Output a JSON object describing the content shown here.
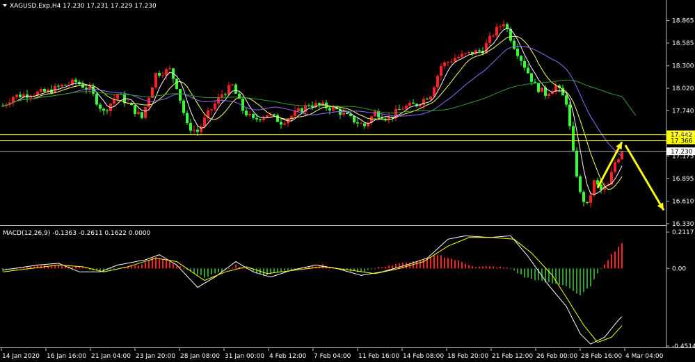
{
  "header": {
    "symbol_line": "XAGUSD.Exp,H4  17.230 17.231 17.229 17.230"
  },
  "colors": {
    "background": "#000000",
    "axis": "#c0c0c0",
    "bull_candle": "#ff2020",
    "bear_candle": "#33ff33",
    "ma_fast": "#ffffff",
    "ma_mid": "#ffff66",
    "ma_slow": "#9966ff",
    "ma_long": "#2e9e2e",
    "level_line": "#ffff00",
    "bid_line": "#aabbd0",
    "arrow": "#ffff00",
    "macd_pos": "#ff2020",
    "macd_neg": "#2e9e2e",
    "macd_line": "#ffffff",
    "signal_line": "#ffff00"
  },
  "chart_data": [
    {
      "type": "candlestick",
      "title": "XAGUSD.Exp,H4  17.230 17.231 17.229 17.230",
      "timeframe": "H4",
      "ylim": [
        16.33,
        19.0
      ],
      "y_ticks": [
        "18.865",
        "18.585",
        "18.300",
        "18.020",
        "17.740",
        "17.455",
        "17.175",
        "16.895",
        "16.610",
        "16.330"
      ],
      "x_ticks": [
        "14 Jan 2020",
        "16 Jan 16:00",
        "21 Jan 04:00",
        "23 Jan 20:00",
        "28 Jan 08:00",
        "31 Jan 00:00",
        "4 Feb 12:00",
        "7 Feb 04:00",
        "11 Feb 16:00",
        "14 Feb 08:00",
        "18 Feb 20:00",
        "21 Feb 12:00",
        "26 Feb 00:00",
        "28 Feb 16:00",
        "4 Mar 04:00"
      ],
      "levels": [
        {
          "label": "17.442",
          "value": 17.442
        },
        {
          "label": "17.366",
          "value": 17.366
        }
      ],
      "bid": {
        "label": "17.230",
        "value": 17.23
      },
      "price_path": [
        {
          "bar": 0,
          "price": 17.8
        },
        {
          "bar": 3,
          "price": 17.92
        },
        {
          "bar": 8,
          "price": 17.95
        },
        {
          "bar": 13,
          "price": 17.98
        },
        {
          "bar": 17,
          "price": 18.05
        },
        {
          "bar": 21,
          "price": 18.1
        },
        {
          "bar": 25,
          "price": 18.0
        },
        {
          "bar": 29,
          "price": 17.72
        },
        {
          "bar": 33,
          "price": 17.95
        },
        {
          "bar": 37,
          "price": 17.78
        },
        {
          "bar": 40,
          "price": 17.65
        },
        {
          "bar": 44,
          "price": 18.2
        },
        {
          "bar": 48,
          "price": 18.25
        },
        {
          "bar": 50,
          "price": 18.05
        },
        {
          "bar": 53,
          "price": 17.55
        },
        {
          "bar": 56,
          "price": 17.48
        },
        {
          "bar": 59,
          "price": 17.7
        },
        {
          "bar": 63,
          "price": 17.95
        },
        {
          "bar": 66,
          "price": 18.05
        },
        {
          "bar": 69,
          "price": 17.75
        },
        {
          "bar": 72,
          "price": 17.62
        },
        {
          "bar": 76,
          "price": 17.7
        },
        {
          "bar": 80,
          "price": 17.6
        },
        {
          "bar": 84,
          "price": 17.7
        },
        {
          "bar": 88,
          "price": 17.82
        },
        {
          "bar": 92,
          "price": 17.8
        },
        {
          "bar": 96,
          "price": 17.75
        },
        {
          "bar": 100,
          "price": 17.64
        },
        {
          "bar": 104,
          "price": 17.55
        },
        {
          "bar": 107,
          "price": 17.72
        },
        {
          "bar": 111,
          "price": 17.65
        },
        {
          "bar": 115,
          "price": 17.78
        },
        {
          "bar": 119,
          "price": 17.82
        },
        {
          "bar": 123,
          "price": 17.95
        },
        {
          "bar": 126,
          "price": 18.3
        },
        {
          "bar": 130,
          "price": 18.4
        },
        {
          "bar": 134,
          "price": 18.45
        },
        {
          "bar": 138,
          "price": 18.5
        },
        {
          "bar": 141,
          "price": 18.7
        },
        {
          "bar": 144,
          "price": 18.85
        },
        {
          "bar": 147,
          "price": 18.55
        },
        {
          "bar": 150,
          "price": 18.3
        },
        {
          "bar": 153,
          "price": 18.05
        },
        {
          "bar": 156,
          "price": 17.95
        },
        {
          "bar": 159,
          "price": 18.05
        },
        {
          "bar": 162,
          "price": 17.85
        },
        {
          "bar": 164,
          "price": 17.2
        },
        {
          "bar": 166,
          "price": 16.7
        },
        {
          "bar": 168,
          "price": 16.55
        },
        {
          "bar": 170,
          "price": 16.85
        },
        {
          "bar": 172,
          "price": 16.75
        },
        {
          "bar": 174,
          "price": 16.8
        },
        {
          "bar": 176,
          "price": 17.1
        },
        {
          "bar": 178,
          "price": 17.23
        }
      ],
      "arrows": [
        {
          "from": {
            "bar": 171,
            "price": 16.78
          },
          "to": {
            "bar": 178,
            "price": 17.35
          }
        },
        {
          "from": {
            "bar": 179,
            "price": 17.31
          },
          "to": {
            "bar": 190,
            "price": 16.5
          }
        }
      ]
    },
    {
      "type": "bar",
      "title": "MACD(12,26,9) -0.1363 -0.2611 0.1622 0.0000",
      "ylim": [
        -0.4514,
        0.2117
      ],
      "y_ticks": [
        "0.2117",
        "0.00",
        "-0.4514"
      ],
      "series": [
        {
          "values_path": [
            {
              "bar": 0,
              "v": -0.01
            },
            {
              "bar": 6,
              "v": 0.01
            },
            {
              "bar": 11,
              "v": 0.02
            },
            {
              "bar": 16,
              "v": 0.015
            },
            {
              "bar": 23,
              "v": 0.01
            },
            {
              "bar": 28,
              "v": -0.02
            },
            {
              "bar": 33,
              "v": 0.0
            },
            {
              "bar": 40,
              "v": 0.02
            },
            {
              "bar": 44,
              "v": 0.07
            },
            {
              "bar": 48,
              "v": 0.04
            },
            {
              "bar": 53,
              "v": -0.01
            },
            {
              "bar": 58,
              "v": -0.05
            },
            {
              "bar": 63,
              "v": -0.02
            },
            {
              "bar": 67,
              "v": 0.02
            },
            {
              "bar": 71,
              "v": -0.01
            },
            {
              "bar": 75,
              "v": -0.04
            },
            {
              "bar": 80,
              "v": -0.02
            },
            {
              "bar": 86,
              "v": 0.01
            },
            {
              "bar": 92,
              "v": 0.02
            },
            {
              "bar": 98,
              "v": -0.01
            },
            {
              "bar": 103,
              "v": -0.02
            },
            {
              "bar": 109,
              "v": 0.01
            },
            {
              "bar": 115,
              "v": 0.03
            },
            {
              "bar": 121,
              "v": 0.05
            },
            {
              "bar": 125,
              "v": 0.08
            },
            {
              "bar": 130,
              "v": 0.05
            },
            {
              "bar": 136,
              "v": 0.01
            },
            {
              "bar": 142,
              "v": 0.01
            },
            {
              "bar": 146,
              "v": 0.0
            },
            {
              "bar": 150,
              "v": -0.05
            },
            {
              "bar": 156,
              "v": -0.08
            },
            {
              "bar": 162,
              "v": -0.1
            },
            {
              "bar": 166,
              "v": -0.16
            },
            {
              "bar": 169,
              "v": -0.1
            },
            {
              "bar": 172,
              "v": 0.0
            },
            {
              "bar": 175,
              "v": 0.08
            },
            {
              "bar": 178,
              "v": 0.15
            }
          ]
        },
        {
          "macd_path": [
            {
              "bar": 0,
              "v": -0.01
            },
            {
              "bar": 5,
              "v": 0.005
            },
            {
              "bar": 10,
              "v": 0.02
            },
            {
              "bar": 16,
              "v": 0.03
            },
            {
              "bar": 22,
              "v": -0.02
            },
            {
              "bar": 28,
              "v": -0.02
            },
            {
              "bar": 33,
              "v": 0.02
            },
            {
              "bar": 41,
              "v": 0.05
            },
            {
              "bar": 45,
              "v": 0.08
            },
            {
              "bar": 50,
              "v": 0.02
            },
            {
              "bar": 56,
              "v": -0.11
            },
            {
              "bar": 61,
              "v": -0.05
            },
            {
              "bar": 67,
              "v": 0.04
            },
            {
              "bar": 72,
              "v": -0.02
            },
            {
              "bar": 77,
              "v": -0.05
            },
            {
              "bar": 83,
              "v": -0.01
            },
            {
              "bar": 90,
              "v": 0.02
            },
            {
              "bar": 96,
              "v": 0.0
            },
            {
              "bar": 103,
              "v": -0.04
            },
            {
              "bar": 109,
              "v": -0.02
            },
            {
              "bar": 116,
              "v": 0.02
            },
            {
              "bar": 122,
              "v": 0.06
            },
            {
              "bar": 128,
              "v": 0.17
            },
            {
              "bar": 133,
              "v": 0.19
            },
            {
              "bar": 140,
              "v": 0.18
            },
            {
              "bar": 146,
              "v": 0.19
            },
            {
              "bar": 151,
              "v": 0.07
            },
            {
              "bar": 157,
              "v": -0.1
            },
            {
              "bar": 162,
              "v": -0.22
            },
            {
              "bar": 166,
              "v": -0.38
            },
            {
              "bar": 169,
              "v": -0.44
            },
            {
              "bar": 173,
              "v": -0.4
            },
            {
              "bar": 177,
              "v": -0.3
            },
            {
              "bar": 179,
              "v": -0.26
            }
          ]
        },
        {
          "signal_path": [
            {
              "bar": 0,
              "v": -0.02
            },
            {
              "bar": 8,
              "v": 0.0
            },
            {
              "bar": 16,
              "v": 0.02
            },
            {
              "bar": 23,
              "v": 0.01
            },
            {
              "bar": 29,
              "v": -0.02
            },
            {
              "bar": 36,
              "v": 0.01
            },
            {
              "bar": 44,
              "v": 0.06
            },
            {
              "bar": 50,
              "v": 0.04
            },
            {
              "bar": 58,
              "v": -0.07
            },
            {
              "bar": 64,
              "v": -0.02
            },
            {
              "bar": 70,
              "v": 0.01
            },
            {
              "bar": 76,
              "v": -0.03
            },
            {
              "bar": 84,
              "v": -0.01
            },
            {
              "bar": 92,
              "v": 0.01
            },
            {
              "bar": 100,
              "v": -0.01
            },
            {
              "bar": 107,
              "v": -0.03
            },
            {
              "bar": 114,
              "v": 0.0
            },
            {
              "bar": 121,
              "v": 0.04
            },
            {
              "bar": 128,
              "v": 0.13
            },
            {
              "bar": 134,
              "v": 0.18
            },
            {
              "bar": 141,
              "v": 0.18
            },
            {
              "bar": 147,
              "v": 0.17
            },
            {
              "bar": 152,
              "v": 0.09
            },
            {
              "bar": 158,
              "v": -0.04
            },
            {
              "bar": 163,
              "v": -0.2
            },
            {
              "bar": 167,
              "v": -0.33
            },
            {
              "bar": 171,
              "v": -0.43
            },
            {
              "bar": 175,
              "v": -0.4
            },
            {
              "bar": 179,
              "v": -0.31
            }
          ]
        }
      ]
    }
  ]
}
